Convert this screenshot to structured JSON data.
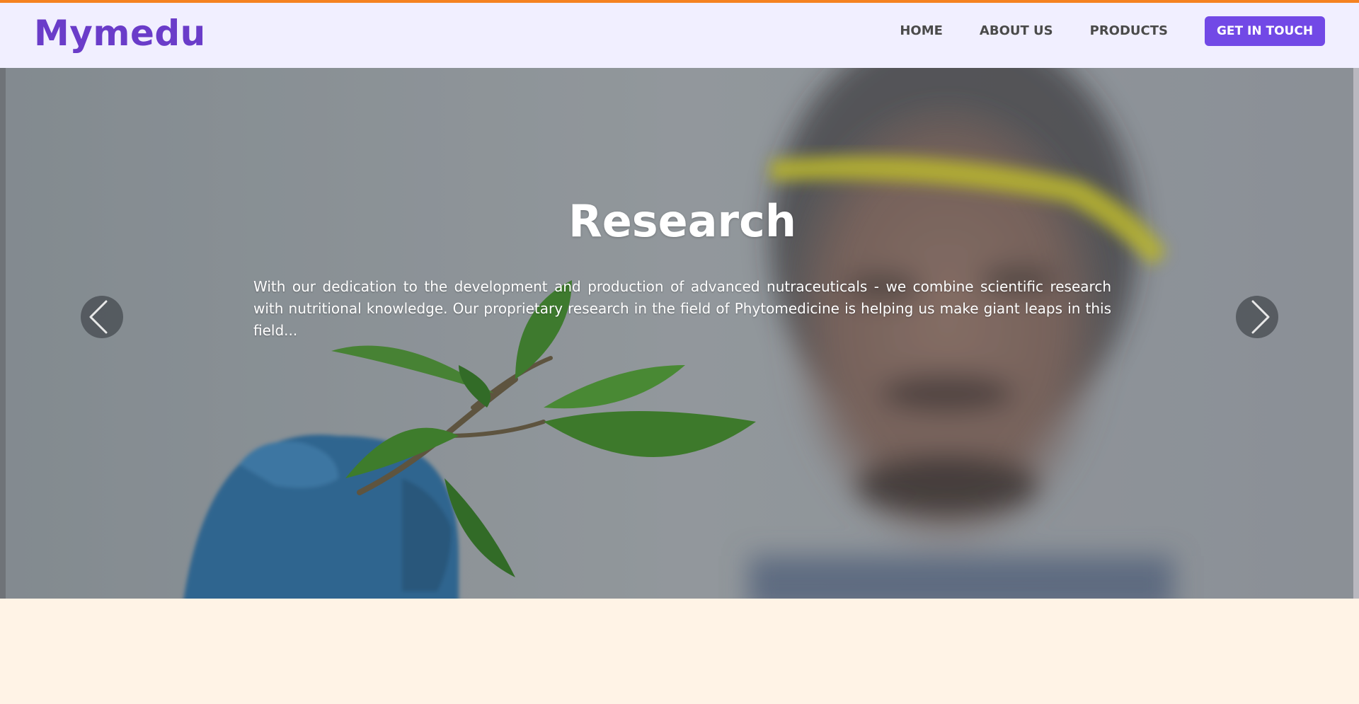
{
  "header": {
    "logo": "Mymedu",
    "nav": {
      "home": "HOME",
      "about": "ABOUT US",
      "products": "PRODUCTS",
      "cta": "GET IN TOUCH"
    }
  },
  "hero": {
    "title": "Research",
    "text": "With our dedication to the development and production of advanced nutraceuticals - we combine scientific research with nutritional knowledge. Our proprietary research in the field of Phytomedicine is helping us make giant leaps in this field...",
    "prev_icon": "chevron-left-icon",
    "next_icon": "chevron-right-icon"
  },
  "colors": {
    "accent_orange": "#f58220",
    "brand_purple": "#6a3cc9",
    "button_purple": "#7249e6",
    "navbar_bg": "#f1efff",
    "page_bg": "#fff3e6"
  }
}
